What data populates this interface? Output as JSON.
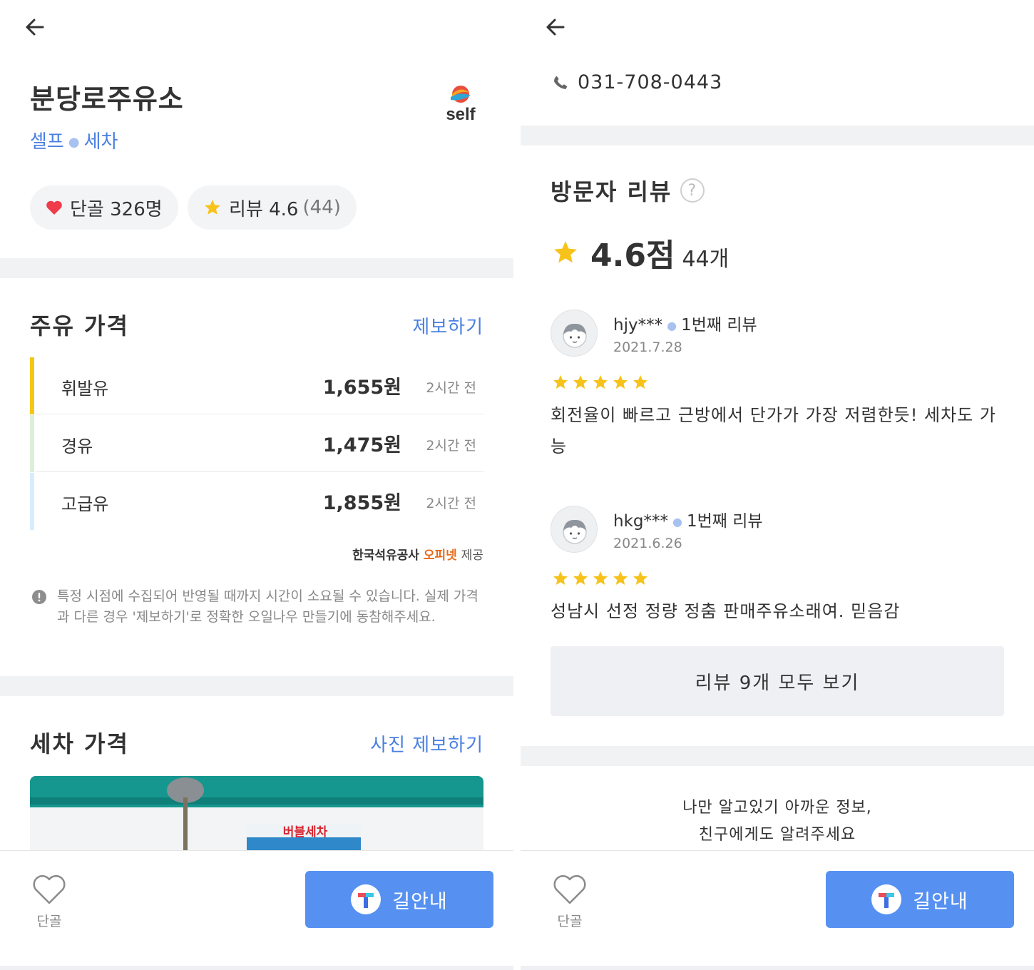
{
  "left": {
    "station_name": "분당로주유소",
    "tags": [
      "셀프",
      "세차"
    ],
    "logo_text": "self",
    "regulars": "단골 326명",
    "review_label": "리뷰 4.6",
    "review_count": "(44)",
    "fuel_section": {
      "title": "주유 가격",
      "report_link": "제보하기",
      "rows": [
        {
          "fuel": "휘발유",
          "price": "1,655원",
          "time": "2시간 전",
          "color": "#f5c518"
        },
        {
          "fuel": "경유",
          "price": "1,475원",
          "time": "2시간 전",
          "color": "#dcefd8"
        },
        {
          "fuel": "고급유",
          "price": "1,855원",
          "time": "2시간 전",
          "color": "#d9ecfa"
        }
      ],
      "provider_prefix": "한국석유공사",
      "provider_brand": "오피넷",
      "provider_suffix": "제공",
      "notice": "특정 시점에 수집되어 반영될 때까지 시간이 소요될 수 있습니다. 실제 가격과 다른 경우 '제보하기'로 정확한 오일나우 만들기에 동참해주세요."
    },
    "wash_section": {
      "title": "세차 가격",
      "photo_link": "사진 제보하기",
      "photo_sign": "버블세차"
    }
  },
  "right": {
    "phone": "031-708-0443",
    "review_section": {
      "title": "방문자 리뷰",
      "help": "?",
      "score": "4.6점",
      "count": "44개",
      "reviews": [
        {
          "user": "hjy***",
          "nth": "1번째 리뷰",
          "date": "2021.7.28",
          "rating": 5,
          "text": "회전율이 빠르고 근방에서 단가가 가장 저렴한듯! 세차도 가능"
        },
        {
          "user": "hkg***",
          "nth": "1번째 리뷰",
          "date": "2021.6.26",
          "rating": 5,
          "text": "성남시 선정 정량 정춤 판매주유소래여. 믿음감"
        }
      ],
      "all_button": "리뷰 9개 모두 보기"
    },
    "share_line1": "나만 알고있기 아까운 정보,",
    "share_line2": "친구에게도 알려주세요"
  },
  "bottom_bar": {
    "fav_label": "단골",
    "nav_label": "길안내"
  },
  "colors": {
    "accent_blue": "#4a7fe0",
    "nav_button": "#5691f2",
    "heart_red": "#ef3b4a",
    "star_yellow": "#f7c31a",
    "opinet_orange": "#e66a1a"
  },
  "icons": [
    "back-arrow-icon",
    "heart-icon",
    "star-icon",
    "phone-icon",
    "help-icon",
    "notice-icon",
    "tmap-icon",
    "avatar-icon"
  ]
}
